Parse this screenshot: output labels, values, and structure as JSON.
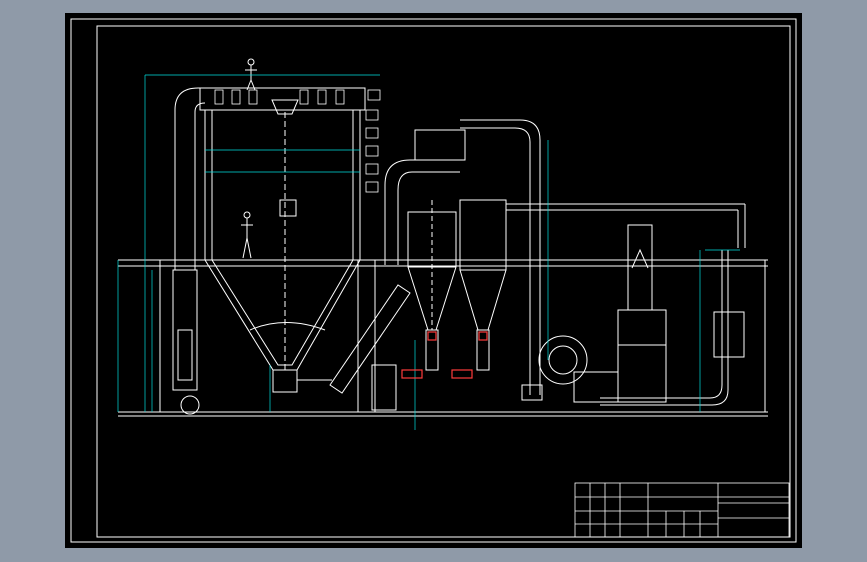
{
  "colors": {
    "viewport_bg": "#8f9aa8",
    "sheet": "#000000",
    "line": "#ffffff",
    "dimension": "#00e0e0",
    "text": "#00ff00",
    "accent": "#ff3b3b"
  },
  "drawing": {
    "kind": "spray-dryer plant elevation",
    "components": [
      "spray-drying-tower",
      "hot-air-duct",
      "cyclone-separator-1",
      "cyclone-separator-2",
      "exhaust-fan",
      "wet-scrubber-tower",
      "control-cabinet",
      "return-pipe"
    ],
    "title_block": {
      "rows": 4,
      "columns": 13
    }
  }
}
